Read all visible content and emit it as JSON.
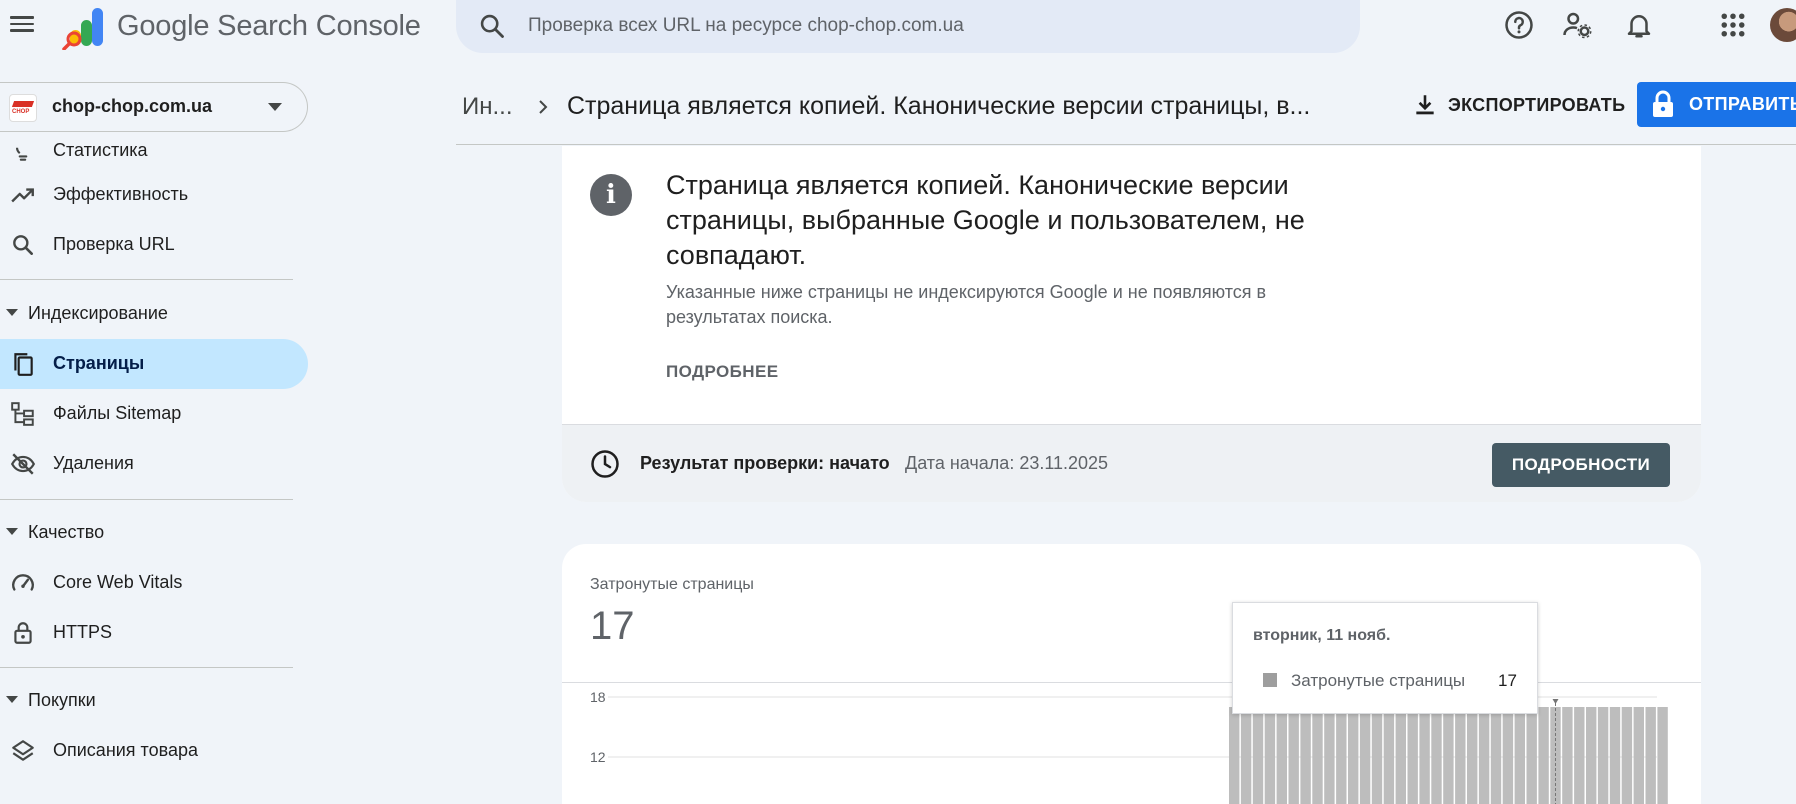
{
  "app": {
    "title": "Google Search Console"
  },
  "search": {
    "placeholder": "Проверка всех URL на ресурсе chop-chop.com.ua"
  },
  "property": {
    "name": "chop-chop.com.ua"
  },
  "sidebar": {
    "items": [
      {
        "label": "Статистика",
        "icon": "lightbulb-icon"
      },
      {
        "label": "Эффективность",
        "icon": "trending-up-icon"
      },
      {
        "label": "Проверка URL",
        "icon": "search-icon"
      }
    ],
    "sections": [
      {
        "label": "Индексирование",
        "items": [
          {
            "label": "Страницы",
            "icon": "pages-icon",
            "active": true
          },
          {
            "label": "Файлы Sitemap",
            "icon": "sitemap-icon"
          },
          {
            "label": "Удаления",
            "icon": "visibility-off-icon"
          }
        ]
      },
      {
        "label": "Качество",
        "items": [
          {
            "label": "Core Web Vitals",
            "icon": "speed-icon"
          },
          {
            "label": "HTTPS",
            "icon": "lock-icon"
          }
        ]
      },
      {
        "label": "Покупки",
        "items": [
          {
            "label": "Описания товара",
            "icon": "layers-icon"
          }
        ]
      }
    ]
  },
  "header": {
    "breadcrumb_root": "Ин...",
    "title": "Страница является копией. Канонические версии страницы, в...",
    "export_label": "ЭКСПОРТИРОВАТЬ",
    "submit_label": "ОТПРАВИТЬ"
  },
  "issue": {
    "title": "Страница является копией. Канонические версии страницы, выбранные Google и пользователем, не совпадают.",
    "description": "Указанные ниже страницы не индексируются Google и не появляются в результатах поиска.",
    "learn_more": "ПОДРОБНЕЕ",
    "validation_label": "Результат проверки: начато",
    "validation_date": "Дата начала: 23.11.2025",
    "details_button": "ПОДРОБНОСТИ"
  },
  "metric": {
    "label": "Затронутые страницы",
    "value": "17"
  },
  "tooltip": {
    "date": "вторник, 11 нояб.",
    "series": "Затронутые страницы",
    "value": "17"
  },
  "colors": {
    "accent": "#1a73e8",
    "active_nav": "#c2e7ff",
    "bar": "#bdbdbd",
    "details_button": "#455a64"
  },
  "chart_data": {
    "type": "bar",
    "yticks": [
      "18",
      "12"
    ],
    "ylim": [
      0,
      18
    ],
    "series": [
      {
        "name": "Затронутые страницы",
        "values": [
          17,
          17,
          17,
          17,
          18,
          18,
          18,
          18,
          18,
          18,
          18,
          18,
          18,
          18,
          18,
          18,
          18,
          18,
          18,
          18,
          18,
          18,
          18,
          18,
          18,
          17,
          17,
          17,
          17,
          17,
          17,
          17,
          17,
          17,
          17,
          17,
          17
        ]
      }
    ],
    "highlight_index": 27
  }
}
